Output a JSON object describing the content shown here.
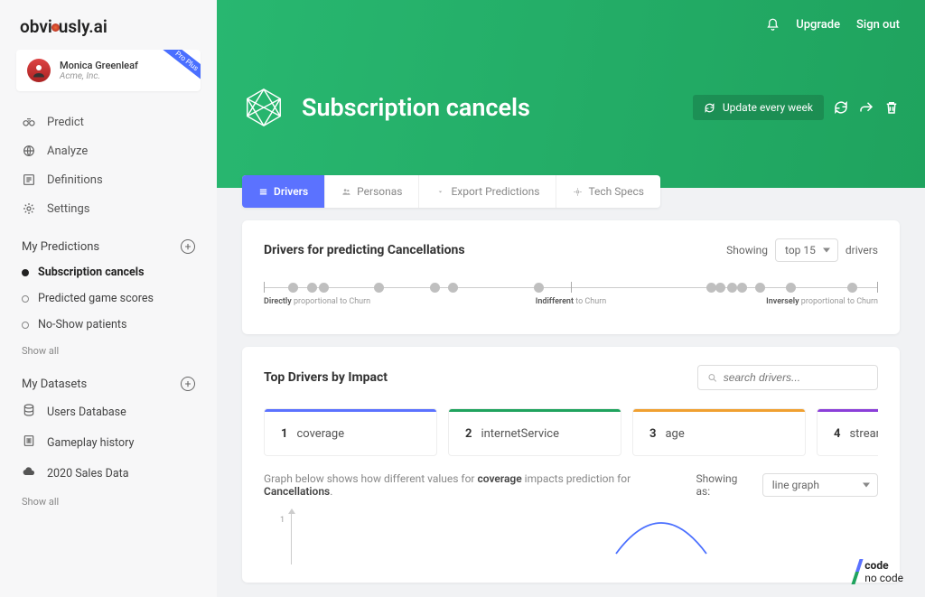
{
  "brand": "obviously.ai",
  "user": {
    "name": "Monica Greenleaf",
    "org": "Acme, Inc.",
    "badge": "Pro Plus"
  },
  "nav": {
    "predict": "Predict",
    "analyze": "Analyze",
    "definitions": "Definitions",
    "settings": "Settings"
  },
  "predictions": {
    "header": "My Predictions",
    "items": [
      {
        "label": "Subscription cancels",
        "active": true
      },
      {
        "label": "Predicted game scores",
        "active": false
      },
      {
        "label": "No-Show patients",
        "active": false
      }
    ],
    "show_all": "Show all"
  },
  "datasets": {
    "header": "My Datasets",
    "items": [
      {
        "label": "Users Database"
      },
      {
        "label": "Gameplay history"
      },
      {
        "label": "2020 Sales Data"
      }
    ],
    "show_all": "Show all"
  },
  "header": {
    "upgrade": "Upgrade",
    "signout": "Sign out",
    "title": "Subscription cancels",
    "update": "Update every week"
  },
  "tabs": [
    {
      "label": "Drivers",
      "active": true
    },
    {
      "label": "Personas"
    },
    {
      "label": "Export Predictions"
    },
    {
      "label": "Tech Specs"
    }
  ],
  "drivers_card": {
    "title": "Drivers for predicting Cancellations",
    "showing_pre": "Showing",
    "showing_val": "top 15",
    "showing_post": "drivers",
    "label_direct_b": "Directly",
    "label_direct_r": " proportional to Churn",
    "label_indiff_b": "Indifferent",
    "label_indiff_r": " to Churn",
    "label_inverse_b": "Inversely",
    "label_inverse_r": " proportional to Churn",
    "dot_positions": [
      4,
      7,
      9,
      18,
      27,
      30,
      44,
      72,
      73.5,
      75.5,
      77,
      80,
      85,
      95
    ]
  },
  "top_card": {
    "title": "Top Drivers by Impact",
    "search_placeholder": "search drivers...",
    "drivers": [
      {
        "n": "1",
        "name": "coverage",
        "color": "#5b72ff"
      },
      {
        "n": "2",
        "name": "internetService",
        "color": "#1fa35e"
      },
      {
        "n": "3",
        "name": "age",
        "color": "#f0a030"
      },
      {
        "n": "4",
        "name": "stream",
        "color": "#8b3fd9"
      }
    ],
    "desc_pre": "Graph below shows how different values for ",
    "desc_b1": "coverage",
    "desc_mid": " impacts prediction for ",
    "desc_b2": "Cancellations",
    "showing_as": "Showing as:",
    "graph_type": "line graph",
    "y_tick": "1"
  },
  "footer": {
    "code": "code",
    "nocode": "no code"
  }
}
